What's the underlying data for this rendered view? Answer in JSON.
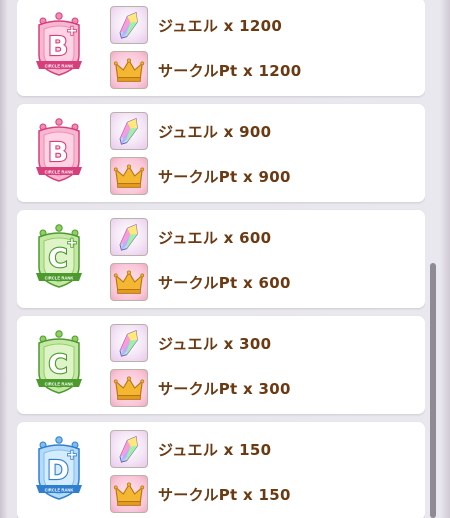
{
  "rows": [
    {
      "rank_letter": "B",
      "rank_plus": "+",
      "rank_color": "pink",
      "circle_rank_text": "CIRCLE RANK",
      "rewards": [
        {
          "icon": "jewel-icon",
          "label": "ジュエル x 1200"
        },
        {
          "icon": "crown-icon",
          "label": "サークルPt x 1200"
        }
      ]
    },
    {
      "rank_letter": "B",
      "rank_plus": "",
      "rank_color": "pink",
      "circle_rank_text": "CIRCLE RANK",
      "rewards": [
        {
          "icon": "jewel-icon",
          "label": "ジュエル x 900"
        },
        {
          "icon": "crown-icon",
          "label": "サークルPt x 900"
        }
      ]
    },
    {
      "rank_letter": "C",
      "rank_plus": "+",
      "rank_color": "green",
      "circle_rank_text": "CIRCLE RANK",
      "rewards": [
        {
          "icon": "jewel-icon",
          "label": "ジュエル x 600"
        },
        {
          "icon": "crown-icon",
          "label": "サークルPt x 600"
        }
      ]
    },
    {
      "rank_letter": "C",
      "rank_plus": "",
      "rank_color": "green",
      "circle_rank_text": "CIRCLE RANK",
      "rewards": [
        {
          "icon": "jewel-icon",
          "label": "ジュエル x 300"
        },
        {
          "icon": "crown-icon",
          "label": "サークルPt x 300"
        }
      ]
    },
    {
      "rank_letter": "D",
      "rank_plus": "+",
      "rank_color": "blue",
      "circle_rank_text": "CIRCLE RANK",
      "rewards": [
        {
          "icon": "jewel-icon",
          "label": "ジュエル x 150"
        },
        {
          "icon": "crown-icon",
          "label": "サークルPt x 150"
        }
      ]
    }
  ],
  "colors": {
    "text": "#6b3a12",
    "pink": "#e8558f",
    "green": "#5aa83a",
    "blue": "#3f8fd8",
    "crown": "#e9a92a"
  }
}
